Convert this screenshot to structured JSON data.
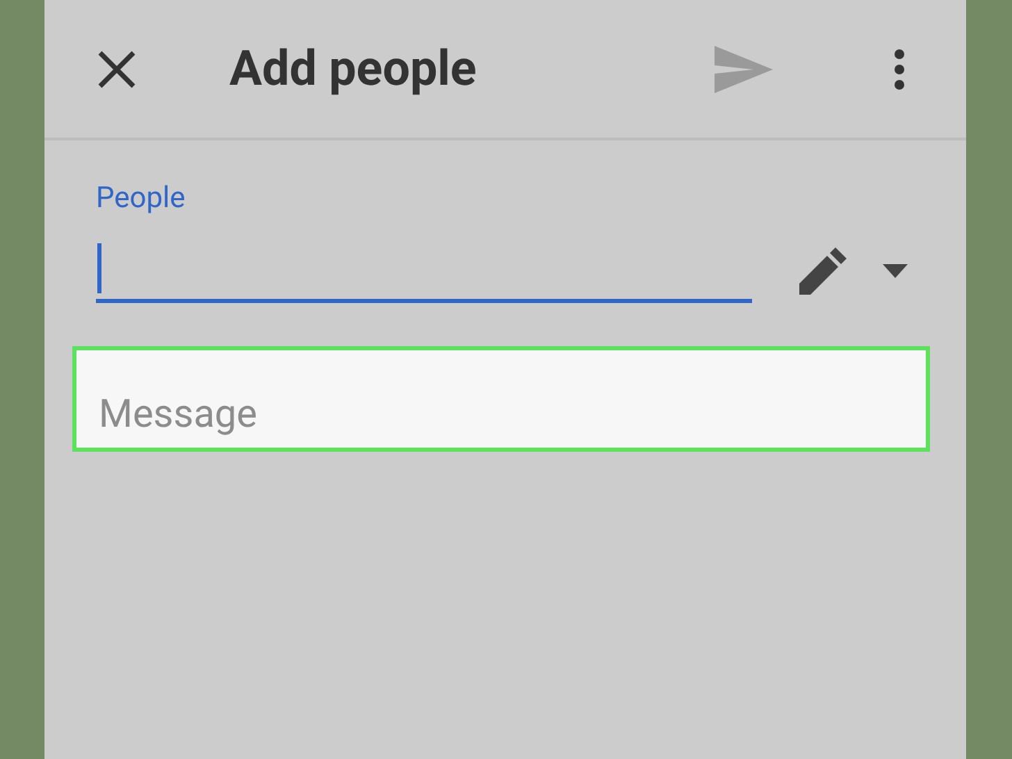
{
  "header": {
    "title": "Add people"
  },
  "people_field": {
    "label": "People",
    "focused": true
  },
  "message_field": {
    "placeholder": "Message",
    "highlighted": true
  }
}
